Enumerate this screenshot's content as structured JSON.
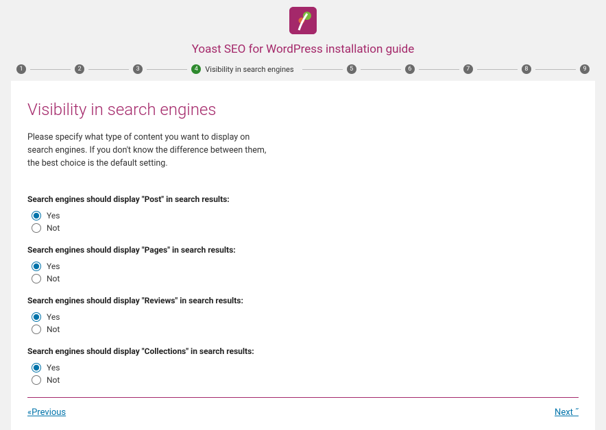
{
  "header": {
    "title": "Yoast SEO for WordPress installation guide"
  },
  "stepper": {
    "steps": [
      {
        "num": "1",
        "label": "",
        "active": false
      },
      {
        "num": "2",
        "label": "",
        "active": false
      },
      {
        "num": "3",
        "label": "",
        "active": false
      },
      {
        "num": "4",
        "label": "Visibility in search engines",
        "active": true
      },
      {
        "num": "5",
        "label": "",
        "active": false
      },
      {
        "num": "6",
        "label": "",
        "active": false
      },
      {
        "num": "7",
        "label": "",
        "active": false
      },
      {
        "num": "8",
        "label": "",
        "active": false
      },
      {
        "num": "9",
        "label": "",
        "active": false
      }
    ]
  },
  "card": {
    "title": "Visibility in search engines",
    "description": "Please specify what type of content you want to display on search engines. If you don't know the difference between them, the best choice is the default setting.",
    "questions": [
      {
        "prompt": "Search engines should display \"Post\" in search results:",
        "yes": "Yes",
        "no": "Not",
        "selected": "yes"
      },
      {
        "prompt": "Search engines should display \"Pages\" in search results:",
        "yes": "Yes",
        "no": "Not",
        "selected": "yes"
      },
      {
        "prompt": "Search engines should display \"Reviews\" in search results:",
        "yes": "Yes",
        "no": "Not",
        "selected": "yes"
      },
      {
        "prompt": "Search engines should display \"Collections\" in search results:",
        "yes": "Yes",
        "no": "Not",
        "selected": "yes"
      }
    ],
    "nav": {
      "prev": "«Previous",
      "next": "Next ˝"
    }
  },
  "colors": {
    "brand": "#a4286a",
    "link": "#0073aa",
    "active_step": "#2e8a2e"
  }
}
